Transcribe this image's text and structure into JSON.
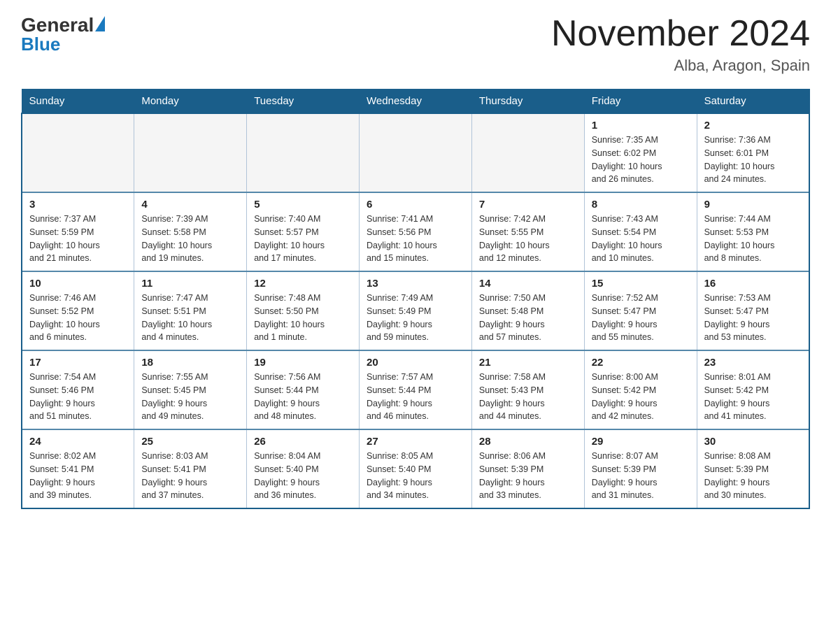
{
  "header": {
    "logo_general": "General",
    "logo_blue": "Blue",
    "calendar_title": "November 2024",
    "calendar_subtitle": "Alba, Aragon, Spain"
  },
  "days_of_week": [
    "Sunday",
    "Monday",
    "Tuesday",
    "Wednesday",
    "Thursday",
    "Friday",
    "Saturday"
  ],
  "weeks": [
    [
      {
        "day": "",
        "info": ""
      },
      {
        "day": "",
        "info": ""
      },
      {
        "day": "",
        "info": ""
      },
      {
        "day": "",
        "info": ""
      },
      {
        "day": "",
        "info": ""
      },
      {
        "day": "1",
        "info": "Sunrise: 7:35 AM\nSunset: 6:02 PM\nDaylight: 10 hours\nand 26 minutes."
      },
      {
        "day": "2",
        "info": "Sunrise: 7:36 AM\nSunset: 6:01 PM\nDaylight: 10 hours\nand 24 minutes."
      }
    ],
    [
      {
        "day": "3",
        "info": "Sunrise: 7:37 AM\nSunset: 5:59 PM\nDaylight: 10 hours\nand 21 minutes."
      },
      {
        "day": "4",
        "info": "Sunrise: 7:39 AM\nSunset: 5:58 PM\nDaylight: 10 hours\nand 19 minutes."
      },
      {
        "day": "5",
        "info": "Sunrise: 7:40 AM\nSunset: 5:57 PM\nDaylight: 10 hours\nand 17 minutes."
      },
      {
        "day": "6",
        "info": "Sunrise: 7:41 AM\nSunset: 5:56 PM\nDaylight: 10 hours\nand 15 minutes."
      },
      {
        "day": "7",
        "info": "Sunrise: 7:42 AM\nSunset: 5:55 PM\nDaylight: 10 hours\nand 12 minutes."
      },
      {
        "day": "8",
        "info": "Sunrise: 7:43 AM\nSunset: 5:54 PM\nDaylight: 10 hours\nand 10 minutes."
      },
      {
        "day": "9",
        "info": "Sunrise: 7:44 AM\nSunset: 5:53 PM\nDaylight: 10 hours\nand 8 minutes."
      }
    ],
    [
      {
        "day": "10",
        "info": "Sunrise: 7:46 AM\nSunset: 5:52 PM\nDaylight: 10 hours\nand 6 minutes."
      },
      {
        "day": "11",
        "info": "Sunrise: 7:47 AM\nSunset: 5:51 PM\nDaylight: 10 hours\nand 4 minutes."
      },
      {
        "day": "12",
        "info": "Sunrise: 7:48 AM\nSunset: 5:50 PM\nDaylight: 10 hours\nand 1 minute."
      },
      {
        "day": "13",
        "info": "Sunrise: 7:49 AM\nSunset: 5:49 PM\nDaylight: 9 hours\nand 59 minutes."
      },
      {
        "day": "14",
        "info": "Sunrise: 7:50 AM\nSunset: 5:48 PM\nDaylight: 9 hours\nand 57 minutes."
      },
      {
        "day": "15",
        "info": "Sunrise: 7:52 AM\nSunset: 5:47 PM\nDaylight: 9 hours\nand 55 minutes."
      },
      {
        "day": "16",
        "info": "Sunrise: 7:53 AM\nSunset: 5:47 PM\nDaylight: 9 hours\nand 53 minutes."
      }
    ],
    [
      {
        "day": "17",
        "info": "Sunrise: 7:54 AM\nSunset: 5:46 PM\nDaylight: 9 hours\nand 51 minutes."
      },
      {
        "day": "18",
        "info": "Sunrise: 7:55 AM\nSunset: 5:45 PM\nDaylight: 9 hours\nand 49 minutes."
      },
      {
        "day": "19",
        "info": "Sunrise: 7:56 AM\nSunset: 5:44 PM\nDaylight: 9 hours\nand 48 minutes."
      },
      {
        "day": "20",
        "info": "Sunrise: 7:57 AM\nSunset: 5:44 PM\nDaylight: 9 hours\nand 46 minutes."
      },
      {
        "day": "21",
        "info": "Sunrise: 7:58 AM\nSunset: 5:43 PM\nDaylight: 9 hours\nand 44 minutes."
      },
      {
        "day": "22",
        "info": "Sunrise: 8:00 AM\nSunset: 5:42 PM\nDaylight: 9 hours\nand 42 minutes."
      },
      {
        "day": "23",
        "info": "Sunrise: 8:01 AM\nSunset: 5:42 PM\nDaylight: 9 hours\nand 41 minutes."
      }
    ],
    [
      {
        "day": "24",
        "info": "Sunrise: 8:02 AM\nSunset: 5:41 PM\nDaylight: 9 hours\nand 39 minutes."
      },
      {
        "day": "25",
        "info": "Sunrise: 8:03 AM\nSunset: 5:41 PM\nDaylight: 9 hours\nand 37 minutes."
      },
      {
        "day": "26",
        "info": "Sunrise: 8:04 AM\nSunset: 5:40 PM\nDaylight: 9 hours\nand 36 minutes."
      },
      {
        "day": "27",
        "info": "Sunrise: 8:05 AM\nSunset: 5:40 PM\nDaylight: 9 hours\nand 34 minutes."
      },
      {
        "day": "28",
        "info": "Sunrise: 8:06 AM\nSunset: 5:39 PM\nDaylight: 9 hours\nand 33 minutes."
      },
      {
        "day": "29",
        "info": "Sunrise: 8:07 AM\nSunset: 5:39 PM\nDaylight: 9 hours\nand 31 minutes."
      },
      {
        "day": "30",
        "info": "Sunrise: 8:08 AM\nSunset: 5:39 PM\nDaylight: 9 hours\nand 30 minutes."
      }
    ]
  ]
}
